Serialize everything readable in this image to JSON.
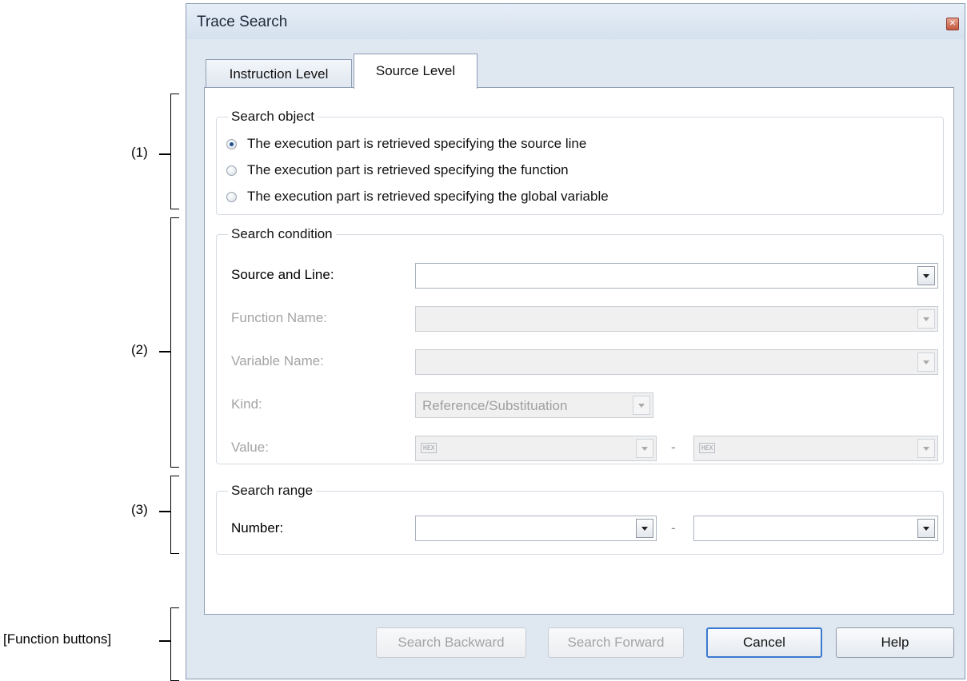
{
  "callouts": {
    "c1": "(1)",
    "c2": "(2)",
    "c3": "(3)",
    "c4": "[Function buttons]"
  },
  "window": {
    "title": "Trace Search",
    "close_icon": "close-icon"
  },
  "tabs": {
    "instruction": "Instruction Level",
    "source": "Source Level"
  },
  "search_object": {
    "legend": "Search object",
    "options": [
      {
        "label": "The execution part is retrieved specifying the source line",
        "checked": true
      },
      {
        "label": "The execution part is retrieved specifying the function",
        "checked": false
      },
      {
        "label": "The execution part is retrieved specifying the global variable",
        "checked": false
      }
    ]
  },
  "search_condition": {
    "legend": "Search condition",
    "source_and_line_label": "Source and Line:",
    "function_name_label": "Function Name:",
    "variable_name_label": "Variable Name:",
    "kind_label": "Kind:",
    "kind_value": "Reference/Substituation",
    "value_label": "Value:",
    "hex_badge": "HEX",
    "range_separator": "-"
  },
  "search_range": {
    "legend": "Search range",
    "number_label": "Number:",
    "range_separator": "-"
  },
  "buttons": {
    "search_backward": "Search Backward",
    "search_forward": "Search Forward",
    "cancel": "Cancel",
    "help": "Help"
  }
}
